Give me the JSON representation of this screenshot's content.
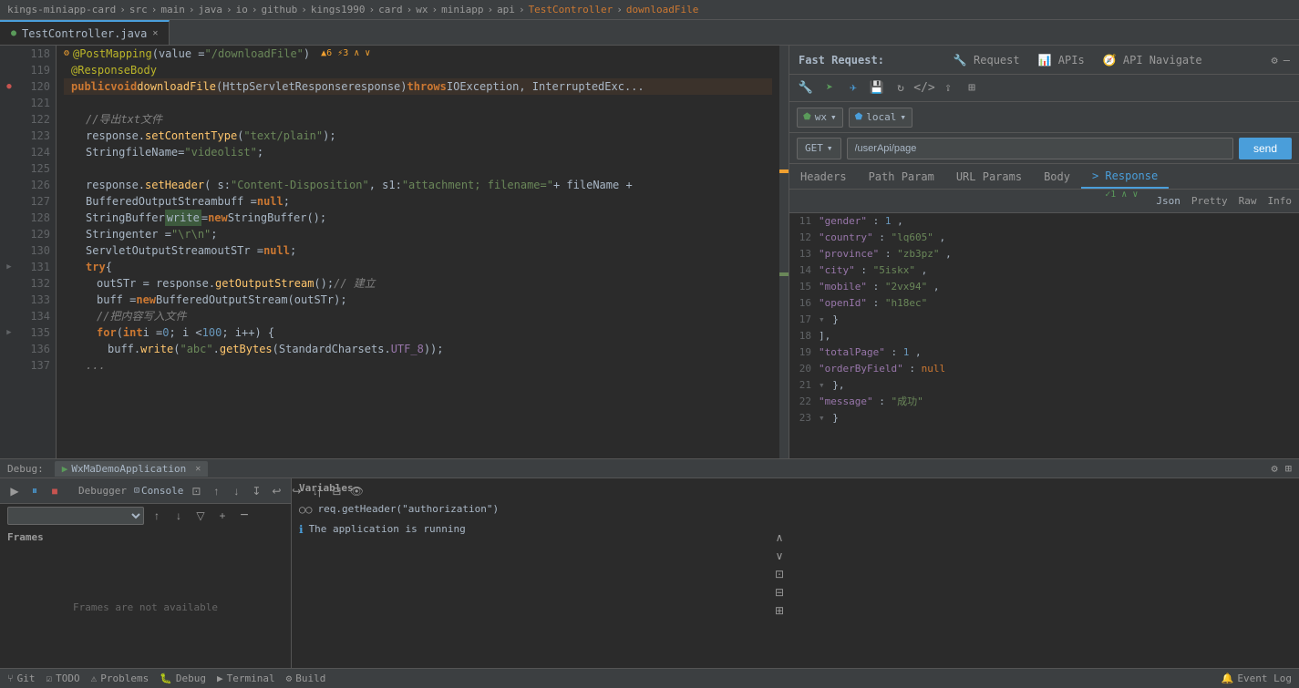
{
  "breadcrumb": {
    "items": [
      "kings-miniapp-card",
      "src",
      "main",
      "java",
      "io",
      "github",
      "kings1990",
      "card",
      "wx",
      "miniapp",
      "api",
      "TestController",
      "downloadFile"
    ]
  },
  "tabs": [
    {
      "label": "TestController.java",
      "active": true
    }
  ],
  "code": {
    "lines": [
      {
        "num": 118,
        "indent": 4,
        "content": "@PostMapping(value = \"/downloadFile\")",
        "type": "annotation",
        "has_warning": true,
        "warning_text": "▲6 ⚡3",
        "has_breakpoint": false
      },
      {
        "num": 119,
        "indent": 4,
        "content": "@ResponseBody",
        "type": "annotation"
      },
      {
        "num": 120,
        "indent": 4,
        "content": "public void downloadFile(HttpServletResponse response) throws IOException, InterruptedExc...",
        "type": "code",
        "has_breakpoint": true
      },
      {
        "num": 121,
        "indent": 0,
        "content": ""
      },
      {
        "num": 122,
        "indent": 8,
        "content": "//导出txt文件",
        "type": "comment"
      },
      {
        "num": 123,
        "indent": 8,
        "content": "response.setContentType(\"text/plain\");",
        "type": "code"
      },
      {
        "num": 124,
        "indent": 8,
        "content": "String fileName=\"videolist\";",
        "type": "code"
      },
      {
        "num": 125,
        "indent": 0,
        "content": ""
      },
      {
        "num": 126,
        "indent": 8,
        "content": "response.setHeader( s: \"Content-Disposition\", s1: \"attachment; filename=\" + fileName +",
        "type": "code"
      },
      {
        "num": 127,
        "indent": 8,
        "content": "BufferedOutputStream buff = null;",
        "type": "code"
      },
      {
        "num": 128,
        "indent": 8,
        "content": "StringBuffer write = new StringBuffer();",
        "type": "code",
        "highlight": "write"
      },
      {
        "num": 129,
        "indent": 8,
        "content": "String enter = \"\\r\\n\";",
        "type": "code"
      },
      {
        "num": 130,
        "indent": 8,
        "content": "ServletOutputStream outSTr = null;",
        "type": "code"
      },
      {
        "num": 131,
        "indent": 8,
        "content": "try {",
        "type": "code",
        "has_fold": true
      },
      {
        "num": 132,
        "indent": 12,
        "content": "outSTr = response.getOutputStream();  // 建立",
        "type": "code"
      },
      {
        "num": 133,
        "indent": 12,
        "content": "buff = new BufferedOutputStream(outSTr);",
        "type": "code"
      },
      {
        "num": 134,
        "indent": 12,
        "content": "//把内容写入文件",
        "type": "comment"
      },
      {
        "num": 135,
        "indent": 12,
        "content": "for (int i = 0; i < 100; i++) {",
        "type": "code",
        "has_fold": true
      },
      {
        "num": 136,
        "indent": 16,
        "content": "buff.write(\"abc\".getBytes(StandardCharsets.UTF_8));",
        "type": "code"
      },
      {
        "num": 137,
        "indent": 0,
        "content": "..."
      }
    ]
  },
  "fast_request": {
    "title": "Fast Request:",
    "tabs": [
      {
        "label": "Request",
        "icon": "🔧",
        "active": false
      },
      {
        "label": "APIs",
        "icon": "📊",
        "active": false
      },
      {
        "label": "API Navigate",
        "icon": "🧭",
        "active": false
      }
    ],
    "toolbar_icons": [
      "wrench",
      "arrow-right",
      "plane",
      "save",
      "refresh",
      "code",
      "settings",
      "share"
    ],
    "env_select": {
      "env_icon": "wx",
      "env_value": "wx",
      "profile_icon": "local",
      "profile_value": "local"
    },
    "method": "GET",
    "url": "/userApi/page",
    "send_label": "send",
    "content_tabs": [
      "Headers",
      "Path Param",
      "URL Params",
      "Body",
      "> Response"
    ],
    "active_content_tab": "> Response",
    "response_tabs": [
      "Json",
      "Pretty",
      "Raw",
      "Info"
    ],
    "active_response_tab": "Json",
    "json_lines": [
      {
        "num": 11,
        "content": "\"gender\": 1,"
      },
      {
        "num": 12,
        "content": "\"country\": \"lq605\","
      },
      {
        "num": 13,
        "content": "\"province\": \"zb3pz\","
      },
      {
        "num": 14,
        "content": "\"city\": \"5iskx\","
      },
      {
        "num": 15,
        "content": "\"mobile\": \"2vx94\","
      },
      {
        "num": 16,
        "content": "\"openId\": \"h18ec\""
      },
      {
        "num": 17,
        "content": "}"
      },
      {
        "num": 18,
        "content": "],"
      },
      {
        "num": 19,
        "content": "\"totalPage\": 1,"
      },
      {
        "num": 20,
        "content": "\"orderByField\": null"
      },
      {
        "num": 21,
        "content": "},"
      },
      {
        "num": 22,
        "content": "\"message\": \"成功\""
      },
      {
        "num": 23,
        "content": "}"
      }
    ],
    "copy_count": "1"
  },
  "debug": {
    "label": "Debug:",
    "app_name": "WxMaDemoApplication",
    "tabs": [
      "Debugger",
      "Console"
    ],
    "active_tab": "Console",
    "frames_label": "Frames",
    "frames_empty": "Frames are not available",
    "variables_label": "Variables",
    "console_entries": [
      {
        "type": "object",
        "icon": "○○",
        "text": "req.getHeader(\"authorization\")"
      },
      {
        "type": "info",
        "icon": "ℹ",
        "text": "The application is running"
      }
    ]
  },
  "status_bar": {
    "git_label": "Git",
    "todo_label": "TODO",
    "problems_label": "Problems",
    "debug_label": "Debug",
    "terminal_label": "Terminal",
    "build_label": "Build",
    "event_log_label": "Event Log"
  }
}
